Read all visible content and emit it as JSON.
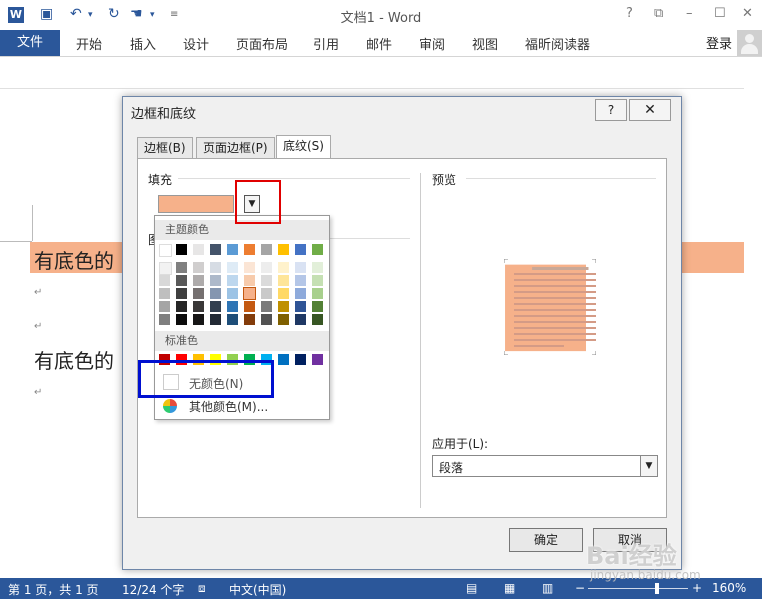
{
  "titlebar": {
    "title": "文档1 - Word",
    "help": "?",
    "minimize": "–"
  },
  "ribbon": {
    "file": "文件",
    "tabs": [
      "开始",
      "插入",
      "设计",
      "页面布局",
      "引用",
      "邮件",
      "审阅",
      "视图",
      "福昕阅读器"
    ],
    "login": "登录"
  },
  "document": {
    "line1": "有底色的",
    "line2": "有底色的",
    "para_mark": "↵",
    "highlight_color": "#f6b18a"
  },
  "dialog": {
    "title": "边框和底纹",
    "help": "?",
    "close": "✕",
    "tabs": [
      "边框(B)",
      "页面边框(P)",
      "底纹(S)"
    ],
    "fill_label": "填充",
    "pattern_label": "图",
    "preview_label": "预览",
    "apply_to_label": "应用于(L):",
    "apply_to_value": "段落",
    "ok": "确定",
    "cancel": "取消",
    "fill_color": "#f6b18a"
  },
  "color_picker": {
    "theme_header": "主题颜色",
    "theme_top": [
      "#ffffff",
      "#000000",
      "#e7e6e6",
      "#44546a",
      "#5b9bd5",
      "#ed7d31",
      "#a5a5a5",
      "#ffc000",
      "#4472c4",
      "#70ad47"
    ],
    "theme_shades": [
      [
        "#f2f2f2",
        "#808080",
        "#d0cece",
        "#d6dce4",
        "#deebf6",
        "#fbe5d5",
        "#ededed",
        "#fff2cc",
        "#d9e2f3",
        "#e2efd9"
      ],
      [
        "#d8d8d8",
        "#595959",
        "#aeabab",
        "#adb9ca",
        "#bdd7ee",
        "#f7cbac",
        "#dbdbdb",
        "#fee599",
        "#b4c6e7",
        "#c5e0b3"
      ],
      [
        "#bfbfbf",
        "#3f3f3f",
        "#757070",
        "#8496b0",
        "#9cc3e5",
        "#f4b183",
        "#c9c9c9",
        "#ffd965",
        "#8eaadb",
        "#a8d08d"
      ],
      [
        "#a5a5a5",
        "#262626",
        "#3a3838",
        "#323f4f",
        "#2e75b5",
        "#c45911",
        "#7b7b7b",
        "#bf9000",
        "#2f5496",
        "#538135"
      ],
      [
        "#7f7f7f",
        "#0c0c0c",
        "#171616",
        "#222a35",
        "#1e4e79",
        "#833c0b",
        "#525252",
        "#7f6000",
        "#1f3864",
        "#375623"
      ]
    ],
    "selected_index": "3-5",
    "standard_header": "标准色",
    "standard": [
      "#c00000",
      "#ff0000",
      "#ffc000",
      "#ffff00",
      "#92d050",
      "#00b050",
      "#00b0f0",
      "#0070c0",
      "#002060",
      "#7030a0"
    ],
    "no_color": "无颜色(N)",
    "more_colors": "其他颜色(M)...",
    "icons": [
      "no-color-icon",
      "palette-icon"
    ]
  },
  "statusbar": {
    "page": "第 1 页，共 1 页",
    "words": "12/24 个字",
    "language": "中文(中国)",
    "zoom": "160%",
    "zoom_minus": "−",
    "zoom_plus": "+"
  },
  "watermark": {
    "logo": "Bai经验",
    "site": "jingyan.baidu.com"
  }
}
